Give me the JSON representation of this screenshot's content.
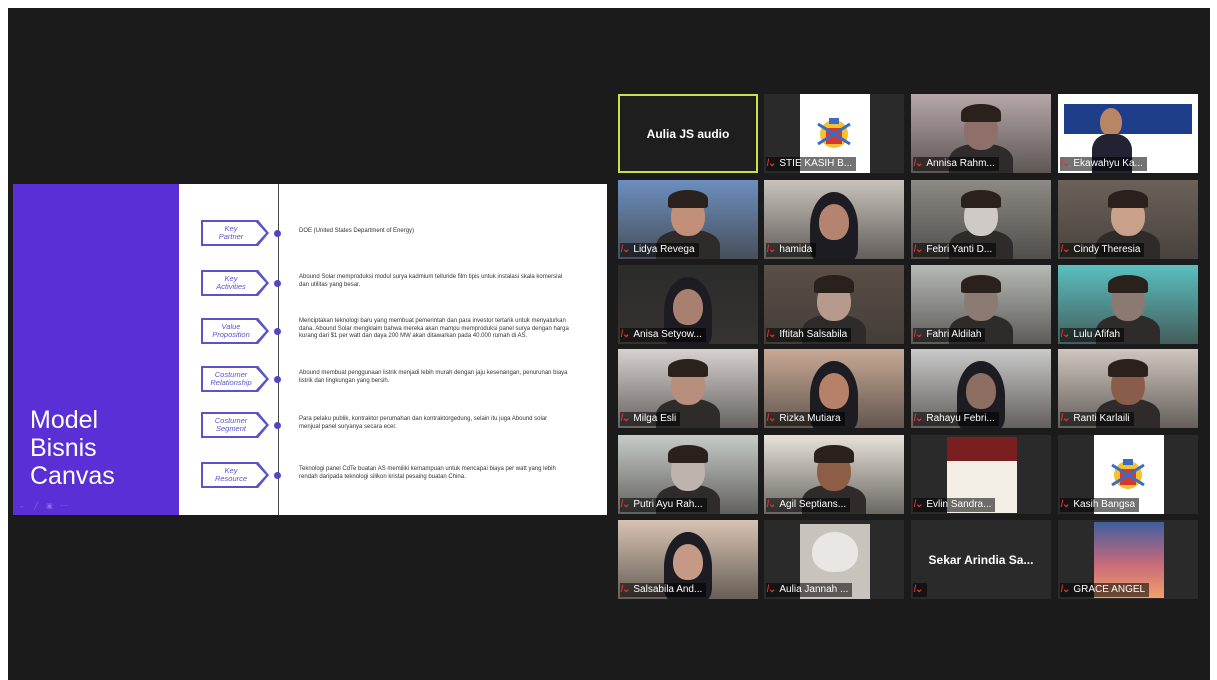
{
  "slide": {
    "title": "Model\nBisnis\nCanvas",
    "controls": "← ╱ ▣ ⋯",
    "rows": [
      {
        "tag": "Key\nPartner",
        "text": "DOE (United States Department of Energy)"
      },
      {
        "tag": "Key\nActivities",
        "text": "Abound Solar memproduksi modul surya kadmium telluride film tipis untuk instalasi skala komersial dan utilitas yang besar."
      },
      {
        "tag": "Value\nProposition",
        "text": "Menciptakan teknologi baru yang membuat pemerintah dan para investor tertarik untuk menyalurkan dana. Abound Solar mengklaim bahwa mereka akan mampu memproduksi panel surya dengan harga kurang dari $1 per watt dan daya 200 MW akan ditawarkan pada 40.000 rumah di AS."
      },
      {
        "tag": "Costumer\nRelationship",
        "text": "Abound membuat penggunaan listrik menjadi lebih murah dengan jaju kesenangan, penurunan biaya listrik dan lingkungan yang bersih."
      },
      {
        "tag": "Costumer\nSegment",
        "text": "Para pelaku publik, kontraktor perumahan dan kontraktorgedung, selain itu juga Abound solar menjual panel suryanya secara ecer."
      },
      {
        "tag": "Key\nResource",
        "text": "Teknologi panel CdTe buatan AS memiliki kemampuan untuk mencapai biaya per watt yang lebih rendah daripada teknologi silikon kristal pesaing buatan China."
      }
    ]
  },
  "participants": [
    {
      "name": "Aulia JS audio",
      "type": "audio",
      "active": true
    },
    {
      "name": "STIE KASIH B...",
      "type": "logo",
      "muted": true
    },
    {
      "name": "Annisa Rahm...",
      "type": "video",
      "muted": true,
      "bg": "#b7a7a8",
      "skin": "#8f6f6a"
    },
    {
      "name": "Ekawahyu Ka...",
      "type": "slide-video",
      "muted": true
    },
    {
      "name": "Lidya Revega",
      "type": "video",
      "muted": true,
      "bg": "#6c8fbf",
      "skin": "#c29078"
    },
    {
      "name": "hamida",
      "type": "video",
      "muted": true,
      "bg": "#c9c3bd",
      "skin": "#b48470",
      "hijab": true
    },
    {
      "name": "Febri Yanti D...",
      "type": "video",
      "muted": true,
      "bg": "#8d8a86",
      "skin": "#cfcac5"
    },
    {
      "name": "Cindy Theresia",
      "type": "video",
      "muted": true,
      "bg": "#6b6159",
      "skin": "#c9a08a"
    },
    {
      "name": "Anisa Setyow...",
      "type": "video",
      "muted": true,
      "bg": "#2b2b2b",
      "skin": "#a98070",
      "hijab": true
    },
    {
      "name": "Iftitah Salsabila",
      "type": "video",
      "muted": true,
      "bg": "#5b4f46",
      "skin": "#b79a8e"
    },
    {
      "name": "Fahri Aldilah",
      "type": "video",
      "muted": true,
      "bg": "#b6b9b4",
      "skin": "#8c7b72"
    },
    {
      "name": "Lulu Afifah",
      "type": "video",
      "muted": true,
      "bg": "#5bbfc0",
      "skin": "#8a7a72"
    },
    {
      "name": "Milga Esli",
      "type": "video",
      "muted": true,
      "bg": "#d7d2cf",
      "skin": "#b88e7c"
    },
    {
      "name": "Rizka Mutiara",
      "type": "video",
      "muted": true,
      "bg": "#c8a996",
      "skin": "#b68168",
      "hijab": true
    },
    {
      "name": "Rahayu Febri...",
      "type": "video",
      "muted": true,
      "bg": "#c9c9c9",
      "skin": "#8c6e63",
      "hijab": true
    },
    {
      "name": "Ranti Karlaili",
      "type": "video",
      "muted": true,
      "bg": "#cfc6bf",
      "skin": "#8a5d4a"
    },
    {
      "name": "Putri Ayu Rah...",
      "type": "video",
      "muted": true,
      "bg": "#c7ccc8",
      "skin": "#bdb4ad"
    },
    {
      "name": "Agil Septians...",
      "type": "video",
      "muted": true,
      "bg": "#e7e2da",
      "skin": "#8d5e45"
    },
    {
      "name": "Evlin Sandra...",
      "type": "poster",
      "muted": true
    },
    {
      "name": "Kasih Bangsa",
      "type": "logo",
      "muted": true
    },
    {
      "name": "Salsabila And...",
      "type": "video",
      "muted": true,
      "bg": "#d8c3b2",
      "skin": "#c49a86",
      "hijab": true
    },
    {
      "name": "Aulia Jannah ...",
      "type": "cartoon",
      "muted": true
    },
    {
      "name": "Sekar Arindia Sa...",
      "type": "audio",
      "muted": true,
      "nameOnly": true
    },
    {
      "name": "GRACE ANGEL",
      "type": "sunset",
      "muted": true
    }
  ],
  "icons": {
    "muted": "mic-muted-icon"
  }
}
